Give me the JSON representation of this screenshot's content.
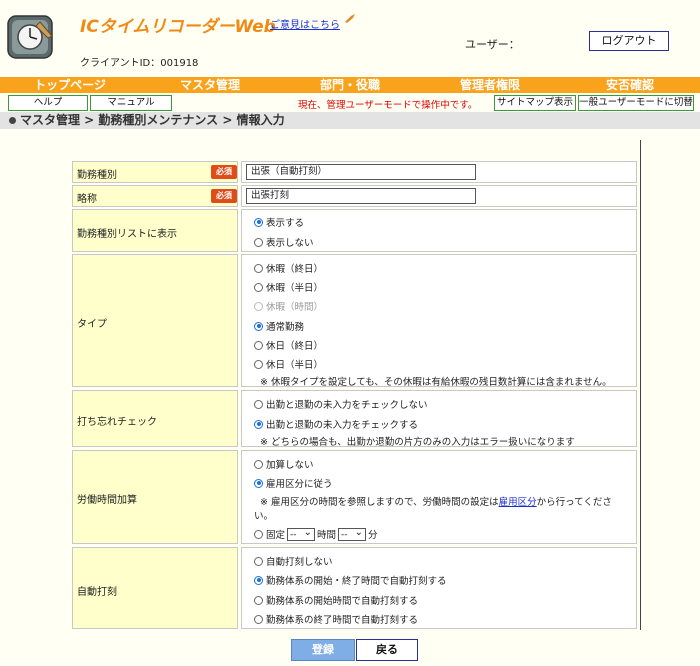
{
  "header": {
    "app_title": "ICタイムリコーダーWeb",
    "feedback_link": "ご意見はこちら",
    "client_id": "クライアントID：001918",
    "user_label": "ユーザー：",
    "logout": "ログアウト"
  },
  "nav": [
    "トップページ",
    "マスタ管理",
    "部門・役職",
    "管理者権限",
    "安否確認"
  ],
  "subbar": {
    "help": "ヘルプ",
    "manual": "マニュアル",
    "mode_text": "現在、管理ユーザーモードで操作中です。",
    "sitemap": "サイトマップ表示",
    "switch_mode": "一般ユーザーモードに切替"
  },
  "breadcrumb": "マスタ管理 > 勤務種別メンテナンス > 情報入力",
  "required_badge": "必須",
  "form": {
    "work_type": {
      "label": "勤務種別",
      "value": "出張（自動打刻）"
    },
    "abbrev": {
      "label": "略称",
      "value": "出張打刻"
    },
    "show_in_list": {
      "label": "勤務種別リストに表示",
      "options": [
        "表示する",
        "表示しない"
      ],
      "selected": 0
    },
    "type": {
      "label": "タイプ",
      "options": [
        "休暇（終日）",
        "休暇（半日）",
        "休暇（時間）",
        "通常勤務",
        "休日（終日）",
        "休日（半日）"
      ],
      "selected": 3,
      "disabled": [
        2
      ],
      "note": "※ 休暇タイプを設定しても、その休暇は有給休暇の残日数計算には含まれません。"
    },
    "forgot_check": {
      "label": "打ち忘れチェック",
      "options": [
        "出勤と退勤の未入力をチェックしない",
        "出勤と退勤の未入力をチェックする"
      ],
      "selected": 1,
      "note": "※ どちらの場合も、出勤か退勤の片方のみの入力はエラー扱いになります"
    },
    "work_time_add": {
      "label": "労働時間加算",
      "options": [
        "加算しない",
        "雇用区分に従う"
      ],
      "selected": 1,
      "note_pre": "※ 雇用区分の時間を参照しますので、労働時間の設定は",
      "note_link": "雇用区分",
      "note_post": "から行ってくださ",
      "note_line2": "い。",
      "fixed_label": "固定",
      "hour_select": "--",
      "hour_unit": "時間",
      "min_select": "--",
      "min_unit": "分"
    },
    "auto_stamp": {
      "label": "自動打刻",
      "options": [
        "自動打刻しない",
        "勤務体系の開始・終了時間で自動打刻する",
        "勤務体系の開始時間で自動打刻する",
        "勤務体系の終了時間で自動打刻する"
      ],
      "selected": 1
    }
  },
  "buttons": {
    "submit": "登録",
    "back": "戻る"
  },
  "colors": {
    "accent": "#f9a21c",
    "title": "#f08a14",
    "label_bg": "#ffffcc",
    "required": "#e04b1a",
    "radio": "#1a6fd8"
  }
}
